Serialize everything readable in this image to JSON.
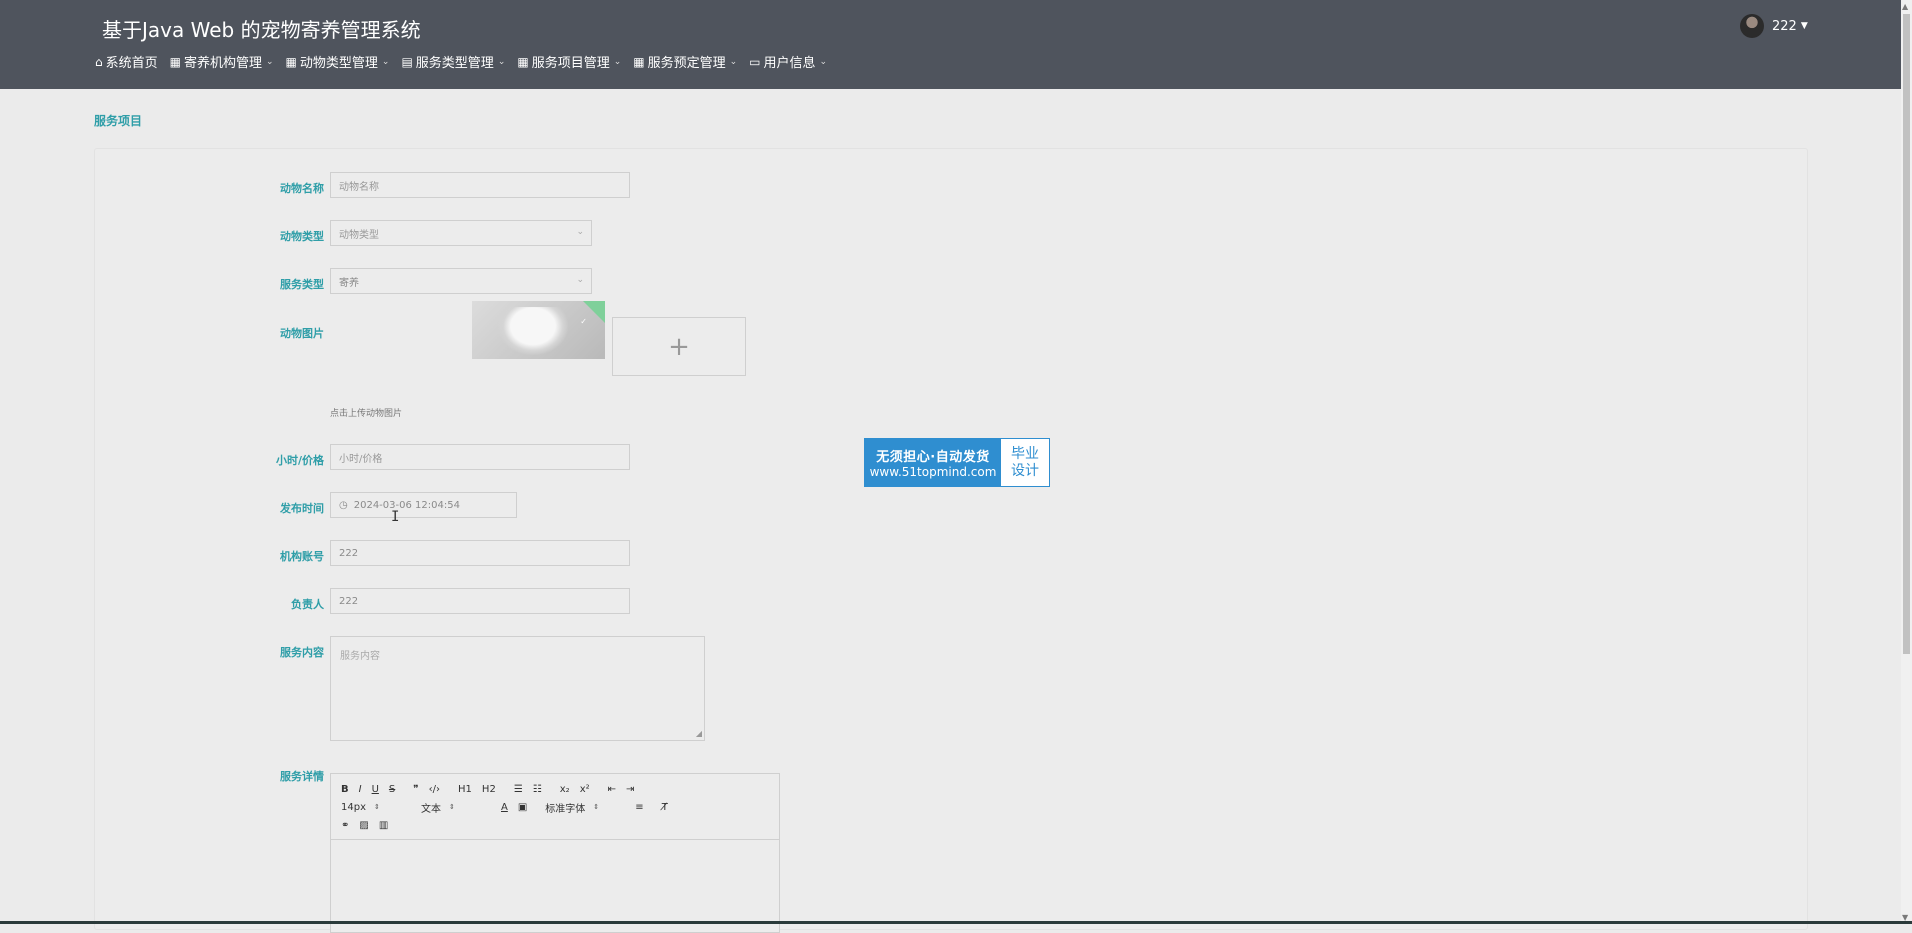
{
  "header": {
    "title": "基于Java Web 的宠物寄养管理系统",
    "user": "222",
    "nav": [
      {
        "icon": "⌂",
        "label": "系统首页",
        "dropdown": false
      },
      {
        "icon": "▦",
        "label": "寄养机构管理",
        "dropdown": true
      },
      {
        "icon": "▦",
        "label": "动物类型管理",
        "dropdown": true
      },
      {
        "icon": "▤",
        "label": "服务类型管理",
        "dropdown": true
      },
      {
        "icon": "▦",
        "label": "服务项目管理",
        "dropdown": true
      },
      {
        "icon": "▦",
        "label": "服务预定管理",
        "dropdown": true
      },
      {
        "icon": "▭",
        "label": "用户信息",
        "dropdown": true
      }
    ]
  },
  "breadcrumb": "服务项目",
  "form": {
    "animal_name": {
      "label": "动物名称",
      "placeholder": "动物名称",
      "value": ""
    },
    "animal_type": {
      "label": "动物类型",
      "value": "动物类型"
    },
    "service_type": {
      "label": "服务类型",
      "value": "寄养"
    },
    "animal_image": {
      "label": "动物图片",
      "hint": "点击上传动物图片",
      "upload_symbol": "+"
    },
    "hourly_price": {
      "label": "小时/价格",
      "placeholder": "小时/价格"
    },
    "publish_time": {
      "label": "发布时间",
      "value": "2024-03-06 12:04:54"
    },
    "org_account": {
      "label": "机构账号",
      "value": "222"
    },
    "person_in_charge": {
      "label": "负责人",
      "value": "222"
    },
    "service_content": {
      "label": "服务内容",
      "placeholder": "服务内容"
    },
    "service_detail": {
      "label": "服务详情",
      "toolbar_row1": [
        "B",
        "I",
        "U",
        "S",
        "❞",
        "‹/›",
        "H1",
        "H2",
        "☰",
        "☷",
        "x₂",
        "x²",
        "⇤",
        "⇥"
      ],
      "font_size": "14px",
      "text_style": "文本",
      "font_family": "标准字体"
    }
  },
  "promo": {
    "line1": "无须担心·自动发货",
    "line2": "www.51topmind.com",
    "right1": "毕业",
    "right2": "设计"
  },
  "colors": {
    "topbar": "#4f545d",
    "accent": "#2f9ea8",
    "promo": "#2f8ed0"
  }
}
